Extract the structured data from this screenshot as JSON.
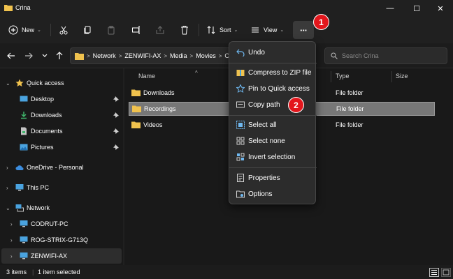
{
  "window": {
    "title": "Crina",
    "minimize_glyph": "—",
    "maximize_glyph": "☐",
    "close_glyph": "✕"
  },
  "toolbar": {
    "new_label": "New",
    "sort_label": "Sort",
    "view_label": "View",
    "more_glyph": "···",
    "icons": [
      "new-icon",
      "cut-icon",
      "copy-icon",
      "paste-icon",
      "rename-icon",
      "share-icon",
      "delete-icon",
      "sort-icon",
      "view-icon",
      "more-icon"
    ]
  },
  "address": {
    "crumbs": [
      "Network",
      "ZENWIFI-AX",
      "Media",
      "Movies",
      "Crina"
    ],
    "search_placeholder": "Search Crina"
  },
  "sidebar": {
    "items": [
      {
        "label": "Quick access",
        "icon": "star-icon"
      },
      {
        "label": "Desktop",
        "icon": "desktop-icon"
      },
      {
        "label": "Downloads",
        "icon": "download-icon"
      },
      {
        "label": "Documents",
        "icon": "documents-icon"
      },
      {
        "label": "Pictures",
        "icon": "pictures-icon"
      },
      {
        "label": "OneDrive - Personal",
        "icon": "cloud-icon"
      },
      {
        "label": "This PC",
        "icon": "computer-icon"
      },
      {
        "label": "Network",
        "icon": "network-icon"
      },
      {
        "label": "CODRUT-PC",
        "icon": "computer-icon"
      },
      {
        "label": "ROG-STRIX-G713Q",
        "icon": "computer-icon"
      },
      {
        "label": "ZENWIFI-AX",
        "icon": "computer-icon"
      }
    ]
  },
  "files": {
    "columns": {
      "name": "Name",
      "type": "Type",
      "size": "Size"
    },
    "rows": [
      {
        "name": "Downloads",
        "type": "File folder"
      },
      {
        "name": "Recordings",
        "type": "File folder"
      },
      {
        "name": "Videos",
        "type": "File folder"
      }
    ]
  },
  "menu": {
    "items": [
      {
        "label": "Undo",
        "icon": "undo-icon"
      },
      {
        "label": "Compress to ZIP file",
        "icon": "zip-icon"
      },
      {
        "label": "Pin to Quick access",
        "icon": "pin-icon"
      },
      {
        "label": "Copy path",
        "icon": "copy-path-icon"
      },
      {
        "label": "Select all",
        "icon": "select-all-icon"
      },
      {
        "label": "Select none",
        "icon": "select-none-icon"
      },
      {
        "label": "Invert selection",
        "icon": "invert-selection-icon"
      },
      {
        "label": "Properties",
        "icon": "properties-icon"
      },
      {
        "label": "Options",
        "icon": "options-icon"
      }
    ]
  },
  "status": {
    "items_count": "3 items",
    "selected_count": "1 item selected"
  },
  "badges": {
    "first": "1",
    "second": "2"
  },
  "colors": {
    "background": "#202020",
    "folder": "#f0c24e",
    "accent_blue": "#4aa3df",
    "badge_red": "#e3161c",
    "selected_row": "#777777"
  }
}
